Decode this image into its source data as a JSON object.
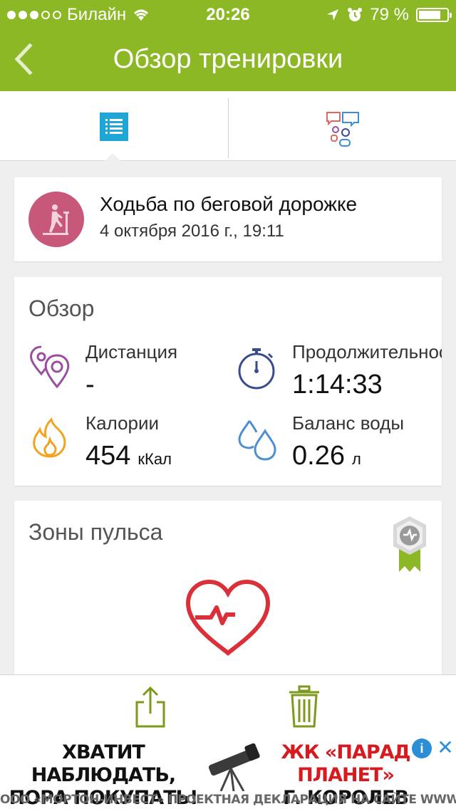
{
  "status_bar": {
    "carrier": "Билайн",
    "time": "20:26",
    "battery": "79 %",
    "signal_bars_filled": 3,
    "signal_bars_total": 5
  },
  "nav": {
    "title": "Обзор тренировки",
    "back_icon": "chevron-left-icon"
  },
  "tabs": [
    {
      "icon": "list-icon",
      "active": true
    },
    {
      "icon": "social-feed-icon",
      "active": false
    }
  ],
  "activity": {
    "name": "Ходьба по беговой дорожке",
    "date": "4 октября 2016 г., 19:11",
    "icon": "treadmill-icon",
    "color": "#c8587a"
  },
  "overview": {
    "title": "Обзор",
    "metrics": {
      "distance": {
        "label": "Дистанция",
        "value": "-",
        "unit": "",
        "icon": "location-pins-icon"
      },
      "duration": {
        "label": "Продолжительность",
        "value": "1:14:33",
        "unit": "",
        "icon": "stopwatch-icon"
      },
      "calories": {
        "label": "Калории",
        "value": "454",
        "unit": "кКал",
        "icon": "flame-icon"
      },
      "water": {
        "label": "Баланс воды",
        "value": "0.26",
        "unit": "л",
        "icon": "water-drops-icon"
      }
    }
  },
  "pulse": {
    "title": "Зоны пульса",
    "badge_icon": "pulse-badge-icon",
    "heart_icon": "heart-pulse-icon"
  },
  "bottom_bar": {
    "share_icon": "share-icon",
    "trash_icon": "trash-icon"
  },
  "ad": {
    "left_line1": "ХВАТИТ НАБЛЮДАТЬ,",
    "left_line2": "ПОРА ПОКУПАТЬ!",
    "right_line1": "ЖК «ПАРАД ПЛАНЕТ»",
    "right_line2": "Г. КОРОЛЕВ",
    "footer": "ООО «МОРТОН-ИНВЕСТ» ПРОЕКТНАЯ ДЕКЛАРАЦИЯ НА САЙТЕ WWW.MORTON.RU",
    "info": "i",
    "close": "✕"
  },
  "colors": {
    "brand_green": "#8db825",
    "tab_blue": "#1ea6d6",
    "icon_purple": "#9b4e9e",
    "icon_navy": "#3b4c8c",
    "icon_orange": "#f2a31f",
    "icon_blue": "#4e8fd1",
    "heart_red": "#d9303a",
    "bar_olive": "#7b9a1e"
  }
}
